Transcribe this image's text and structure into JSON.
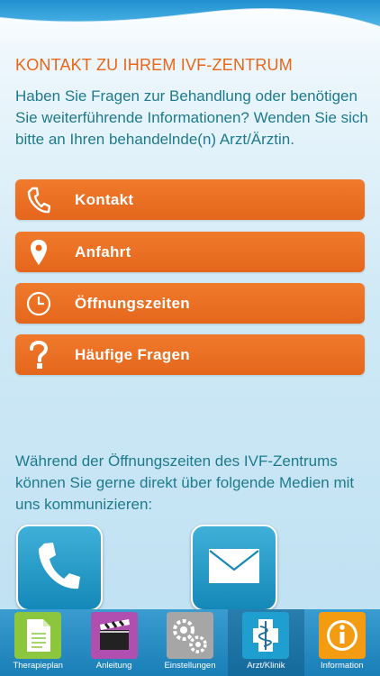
{
  "header": {
    "title": "KONTAKT ZU IHREM IVF-ZENTRUM",
    "intro": "Haben Sie Fragen zur Behandlung oder benötigen Sie weiterführende Informationen? Wenden Sie sich bitte an Ihren behandelnde(n) Arzt/Ärztin."
  },
  "menu": {
    "items": [
      {
        "label": "Kontakt",
        "icon": "phone-icon"
      },
      {
        "label": "Anfahrt",
        "icon": "location-pin-icon"
      },
      {
        "label": "Öffnungszeiten",
        "icon": "clock-icon"
      },
      {
        "label": "Häufige Fragen",
        "icon": "question-icon"
      }
    ]
  },
  "media": {
    "text": "Während der Öffnungszeiten des IVF-Zentrums können Sie gerne direkt über folgende Medien mit uns kommunizieren:",
    "items": [
      {
        "icon": "phone-icon"
      },
      {
        "icon": "mail-icon"
      }
    ]
  },
  "tabbar": {
    "active": "Arzt/Klinik",
    "tabs": [
      {
        "label": "Therapieplan",
        "icon": "document-icon",
        "color": "#8cc63f"
      },
      {
        "label": "Anleitung",
        "icon": "clapperboard-icon",
        "color": "#b04fb0"
      },
      {
        "label": "Einstellungen",
        "icon": "gears-icon",
        "color": "#9a9a9a"
      },
      {
        "label": "Arzt/Klinik",
        "icon": "caduceus-icon",
        "color": "#1f9ed0"
      },
      {
        "label": "Information",
        "icon": "info-icon",
        "color": "#f39c12"
      }
    ]
  },
  "colors": {
    "accent": "#e8661a",
    "text": "#1f7a8c",
    "tabbar": "#1a7fb7"
  }
}
